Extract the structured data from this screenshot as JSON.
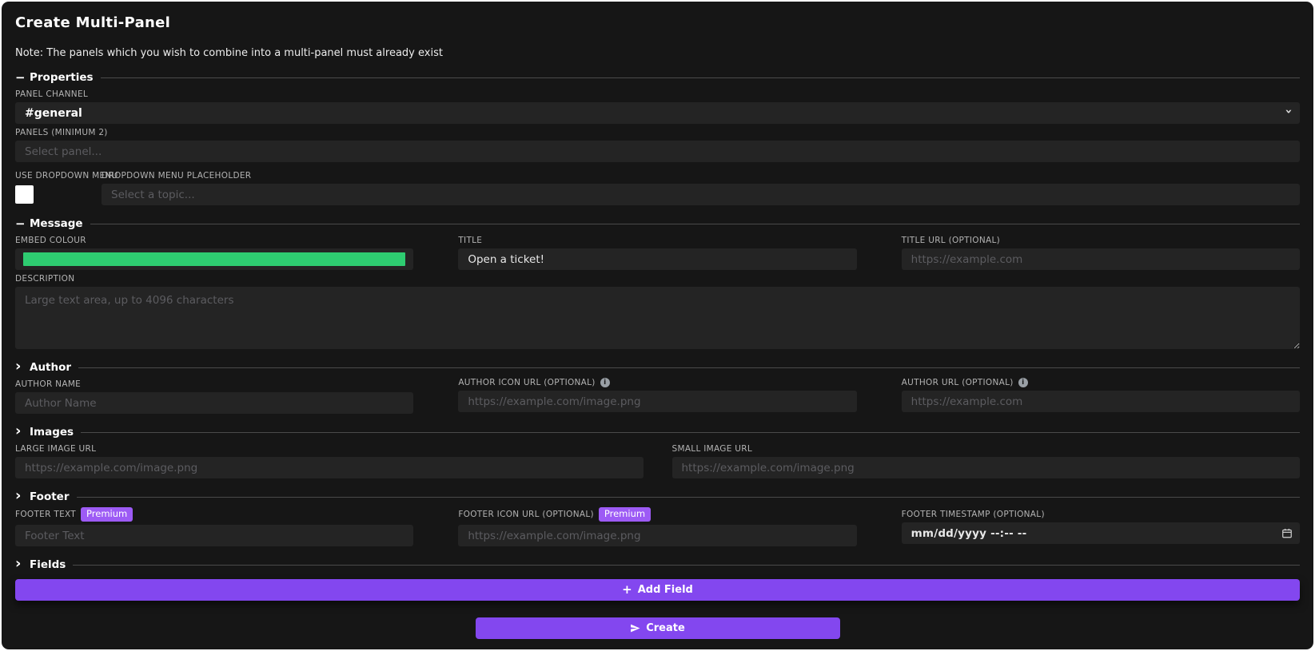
{
  "icons": {
    "collapse": "−",
    "expand": "›",
    "info": "i",
    "plus": "+"
  },
  "colors": {
    "accent": "#8347ef",
    "badge": "#9d5bf5"
  },
  "header": {
    "title": "Create Multi-Panel",
    "note": "Note: The panels which you wish to combine into a multi-panel must already exist"
  },
  "sections": {
    "properties": {
      "title": "Properties",
      "panel_channel_label": "PANEL CHANNEL",
      "panel_channel_value": "#general",
      "panels_label": "PANELS (MINIMUM 2)",
      "panels_placeholder": "Select panel...",
      "use_dropdown_label": "USE DROPDOWN MENU",
      "dropdown_placeholder_label": "DROPDOWN MENU PLACEHOLDER",
      "dropdown_placeholder_placeholder": "Select a topic..."
    },
    "message": {
      "title": "Message",
      "embed_colour_label": "EMBED COLOUR",
      "embed_colour_value": "#2ECC71",
      "title_label": "TITLE",
      "title_value": "Open a ticket!",
      "title_url_label": "TITLE URL (OPTIONAL)",
      "title_url_placeholder": "https://example.com",
      "description_label": "DESCRIPTION",
      "description_placeholder": "Large text area, up to 4096 characters"
    },
    "author": {
      "title": "Author",
      "name_label": "AUTHOR NAME",
      "name_placeholder": "Author Name",
      "icon_url_label": "AUTHOR ICON URL (OPTIONAL)",
      "icon_url_placeholder": "https://example.com/image.png",
      "url_label": "AUTHOR URL (OPTIONAL)",
      "url_placeholder": "https://example.com"
    },
    "images": {
      "title": "Images",
      "large_label": "LARGE IMAGE URL",
      "large_placeholder": "https://example.com/image.png",
      "small_label": "SMALL IMAGE URL",
      "small_placeholder": "https://example.com/image.png"
    },
    "footer": {
      "title": "Footer",
      "text_label": "FOOTER TEXT",
      "text_badge": "Premium",
      "text_placeholder": "Footer Text",
      "icon_url_label": "FOOTER ICON URL (OPTIONAL)",
      "icon_url_badge": "Premium",
      "icon_url_placeholder": "https://example.com/image.png",
      "timestamp_label": "FOOTER TIMESTAMP (OPTIONAL)",
      "timestamp_value": "mm/dd/yyyy --:-- --"
    },
    "fields": {
      "title": "Fields",
      "add_field_label": "Add Field"
    }
  },
  "actions": {
    "create_label": "Create"
  }
}
